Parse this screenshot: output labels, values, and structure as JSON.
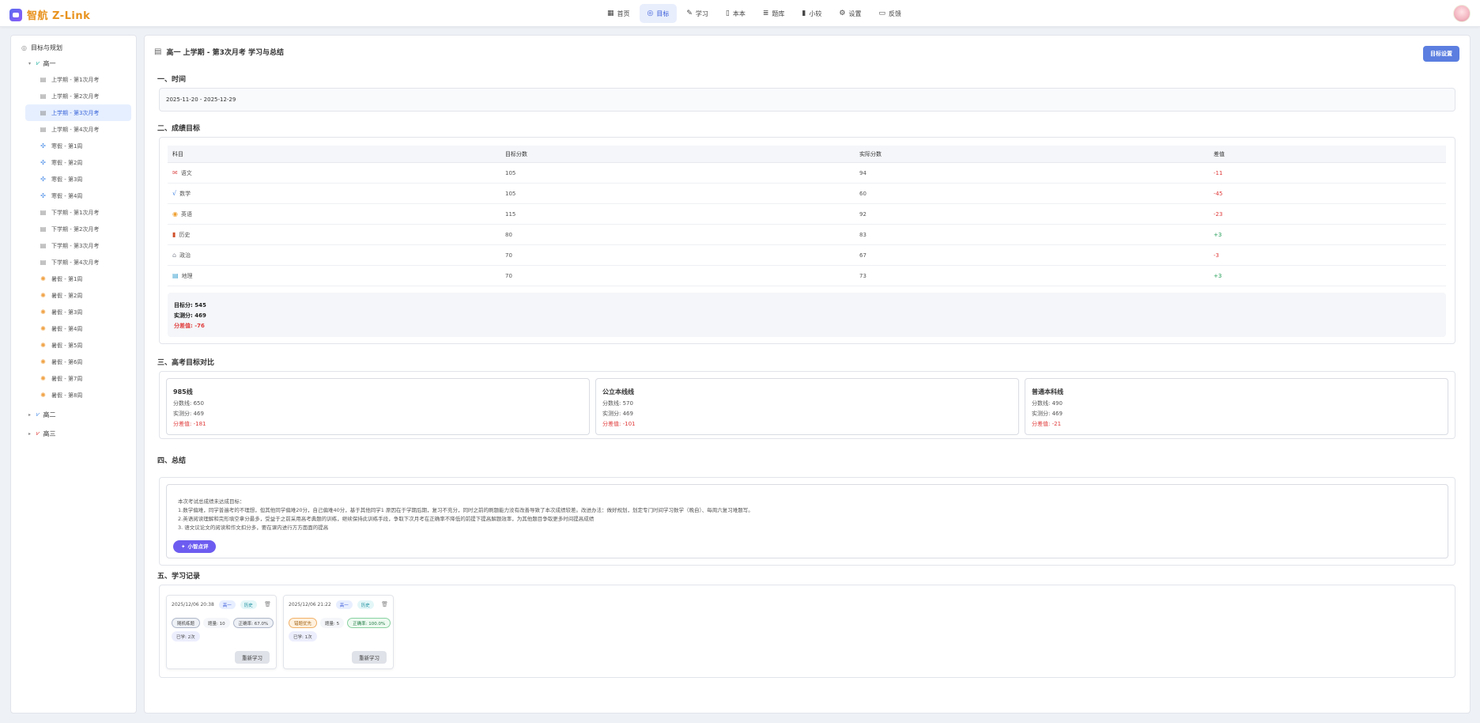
{
  "app": {
    "name": "智航 Z-Link"
  },
  "nav": [
    {
      "icon": "▦",
      "label": "首页",
      "active": false
    },
    {
      "icon": "◎",
      "label": "目标",
      "active": true
    },
    {
      "icon": "✎",
      "label": "学习",
      "active": false
    },
    {
      "icon": "▯",
      "label": "本本",
      "active": false
    },
    {
      "icon": "≣",
      "label": "题库",
      "active": false
    },
    {
      "icon": "▮",
      "label": "小较",
      "active": false
    },
    {
      "icon": "⚙",
      "label": "设置",
      "active": false
    },
    {
      "icon": "▭",
      "label": "反馈",
      "active": false
    }
  ],
  "sidebar": {
    "root": "目标与规划",
    "groups": [
      {
        "label": "高一",
        "expanded": true,
        "color": "#1fb0a0"
      },
      {
        "label": "高二",
        "expanded": false,
        "color": "#4c8ee8"
      },
      {
        "label": "高三",
        "expanded": false,
        "color": "#e03a3a"
      }
    ],
    "items": [
      {
        "label": "上学期 - 第1次月考",
        "type": "doc"
      },
      {
        "label": "上学期 - 第2次月考",
        "type": "doc"
      },
      {
        "label": "上学期 - 第3次月考",
        "type": "doc",
        "active": true
      },
      {
        "label": "上学期 - 第4次月考",
        "type": "doc"
      },
      {
        "label": "寒假 - 第1周",
        "type": "week"
      },
      {
        "label": "寒假 - 第2周",
        "type": "week"
      },
      {
        "label": "寒假 - 第3周",
        "type": "week"
      },
      {
        "label": "寒假 - 第4周",
        "type": "week"
      },
      {
        "label": "下学期 - 第1次月考",
        "type": "doc"
      },
      {
        "label": "下学期 - 第2次月考",
        "type": "doc"
      },
      {
        "label": "下学期 - 第3次月考",
        "type": "doc"
      },
      {
        "label": "下学期 - 第4次月考",
        "type": "doc"
      },
      {
        "label": "暑假 - 第1周",
        "type": "sun"
      },
      {
        "label": "暑假 - 第2周",
        "type": "sun"
      },
      {
        "label": "暑假 - 第3周",
        "type": "sun"
      },
      {
        "label": "暑假 - 第4周",
        "type": "sun"
      },
      {
        "label": "暑假 - 第5周",
        "type": "sun"
      },
      {
        "label": "暑假 - 第6周",
        "type": "sun"
      },
      {
        "label": "暑假 - 第7周",
        "type": "sun"
      },
      {
        "label": "暑假 - 第8周",
        "type": "sun"
      }
    ]
  },
  "page": {
    "title": "高一 上学期 - 第3次月考 学习与总结",
    "goal_button": "目标设置"
  },
  "sections": {
    "time": "一、时间",
    "scores": "二、成绩目标",
    "gaokao": "三、高考目标对比",
    "summary": "四、总结",
    "records": "五、学习记录"
  },
  "time_range": "2025-11-20 - 2025-12-29",
  "score_table": {
    "headers": [
      "科目",
      "目标分数",
      "实际分数",
      "差值"
    ],
    "rows": [
      {
        "subject": "语文",
        "icon": "✉",
        "icon_color": "#e05a5a",
        "target": "105",
        "actual": "94",
        "diff": "-11"
      },
      {
        "subject": "数学",
        "icon": "√",
        "icon_color": "#3a7ee0",
        "target": "105",
        "actual": "60",
        "diff": "-45"
      },
      {
        "subject": "英语",
        "icon": "◉",
        "icon_color": "#f0a030",
        "target": "115",
        "actual": "92",
        "diff": "-23"
      },
      {
        "subject": "历史",
        "icon": "▮",
        "icon_color": "#d0502a",
        "target": "80",
        "actual": "83",
        "diff": "+3"
      },
      {
        "subject": "政治",
        "icon": "⌂",
        "icon_color": "#8a8f9c",
        "target": "70",
        "actual": "67",
        "diff": "-3"
      },
      {
        "subject": "地理",
        "icon": "▤",
        "icon_color": "#3aa0d0",
        "target": "70",
        "actual": "73",
        "diff": "+3"
      }
    ]
  },
  "score_summary": {
    "target": "目标分: 545",
    "actual": "实测分: 469",
    "gap": "分差值: -76"
  },
  "gaokao": [
    {
      "title": "985线",
      "line": "分数线: 650",
      "actual": "实测分: 469",
      "gap": "分差值: -181"
    },
    {
      "title": "公立本线线",
      "line": "分数线: 570",
      "actual": "实测分: 469",
      "gap": "分差值: -101"
    },
    {
      "title": "普通本科线",
      "line": "分数线: 490",
      "actual": "实测分: 469",
      "gap": "分差值: -21"
    }
  ],
  "summary": {
    "lines": [
      "本次考试总成绩未达成目标：",
      "1.数学偏难，同学普遍考的不理想，但其他同学偏难20分，自己偏难40分，基于其他同学1 原因在于学期后期，复习不充分，同时之前的刷题能力没有改善导致了本次成绩较差。改进办法：做好规划，划定专门时间学习数学（晚自）、每周六复习难题写。",
      "2.英语阅读理解和完形填空拿分最多，受益于之前采用高考典题的训练，继续保持此训练手段，争取下次月考在正确率不降低的前提下提高解题效率，为其他题目争取更多时间提高成绩",
      "3. 语文议论文的阅读和作文扣分多，要在课内进行方方面面的提高"
    ],
    "ai_button": "小智点评"
  },
  "records": [
    {
      "date": "2025/12/06 20:38",
      "grade": "高一",
      "subject": "历史",
      "mode": "随机练题",
      "mode_style": "gray",
      "count": "题量: 10",
      "accuracy": "正确率: 67.0%",
      "accuracy_style": "gray",
      "duration": "已学: 2次",
      "relearn": "重新学习"
    },
    {
      "date": "2025/12/06 21:22",
      "grade": "高一",
      "subject": "历史",
      "mode": "错题优先",
      "mode_style": "orange",
      "count": "题量: 5",
      "accuracy": "正确率: 100.0%",
      "accuracy_style": "green",
      "duration": "已学: 1次",
      "relearn": "重新学习"
    }
  ],
  "colors": {
    "accent": "#5b7ee0",
    "negative": "#e03a3a",
    "positive": "#1f9d55",
    "brand": "#e8931f"
  }
}
